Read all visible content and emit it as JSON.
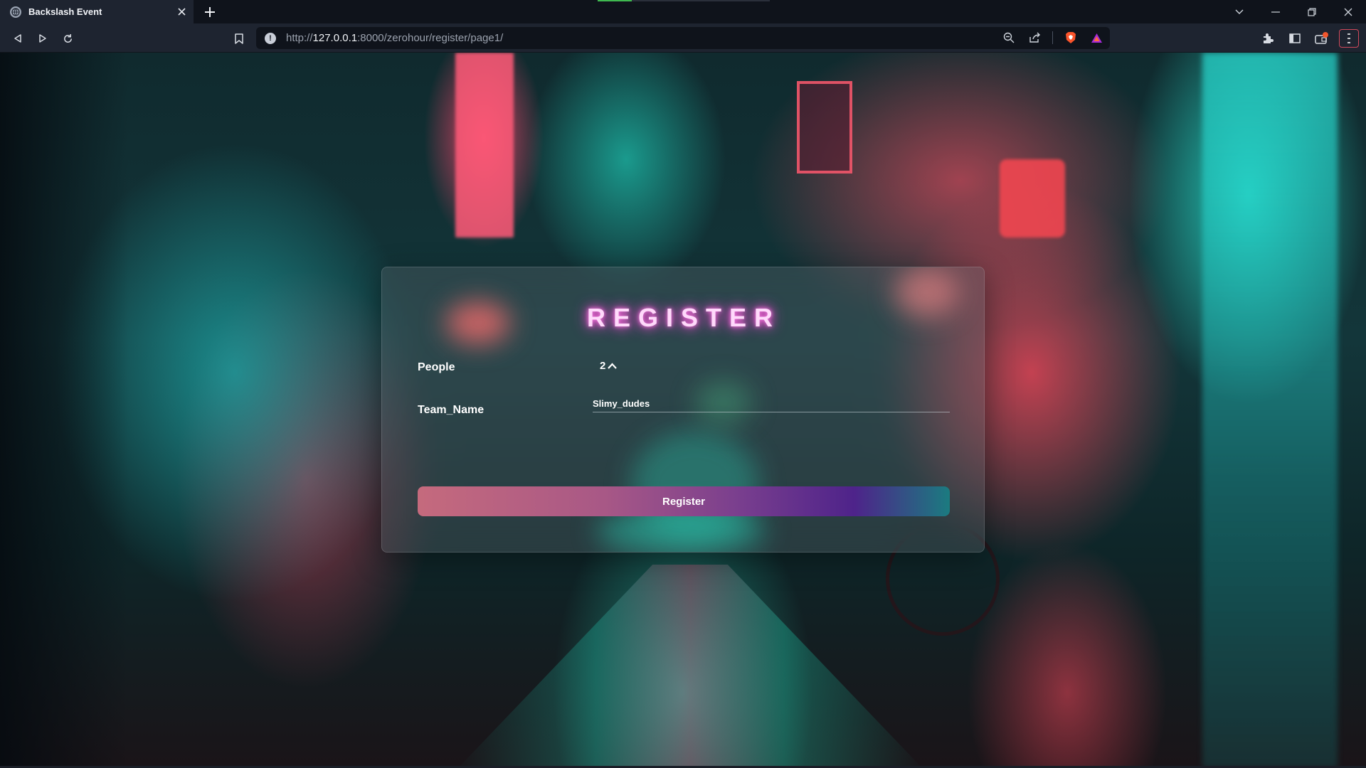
{
  "browser": {
    "tab_title": "Backslash Event",
    "url_prefix": "http://",
    "url_host": "127.0.0.1",
    "url_path": ":8000/zerohour/register/page1/",
    "icons": {
      "back": "back-icon",
      "forward": "forward-icon",
      "reload": "reload-icon",
      "bookmark": "bookmark-icon",
      "zoom": "zoom-icon",
      "share": "share-icon",
      "brave": "brave-shield-icon",
      "rewards": "brave-rewards-icon",
      "extensions": "puzzle-icon",
      "sidebar": "sidebar-icon",
      "wallet": "wallet-icon",
      "menu": "hamburger-menu-icon"
    }
  },
  "form": {
    "title": "REGISTER",
    "people_label": "People",
    "people_value": "2",
    "team_label": "Team_Name",
    "team_value": "Slimy_dudes",
    "submit_label": "Register"
  },
  "colors": {
    "title_glow": "#ff4fd6",
    "button_start": "#c56a7d",
    "button_mid": "#4e238a",
    "button_end": "#1b7b80"
  }
}
